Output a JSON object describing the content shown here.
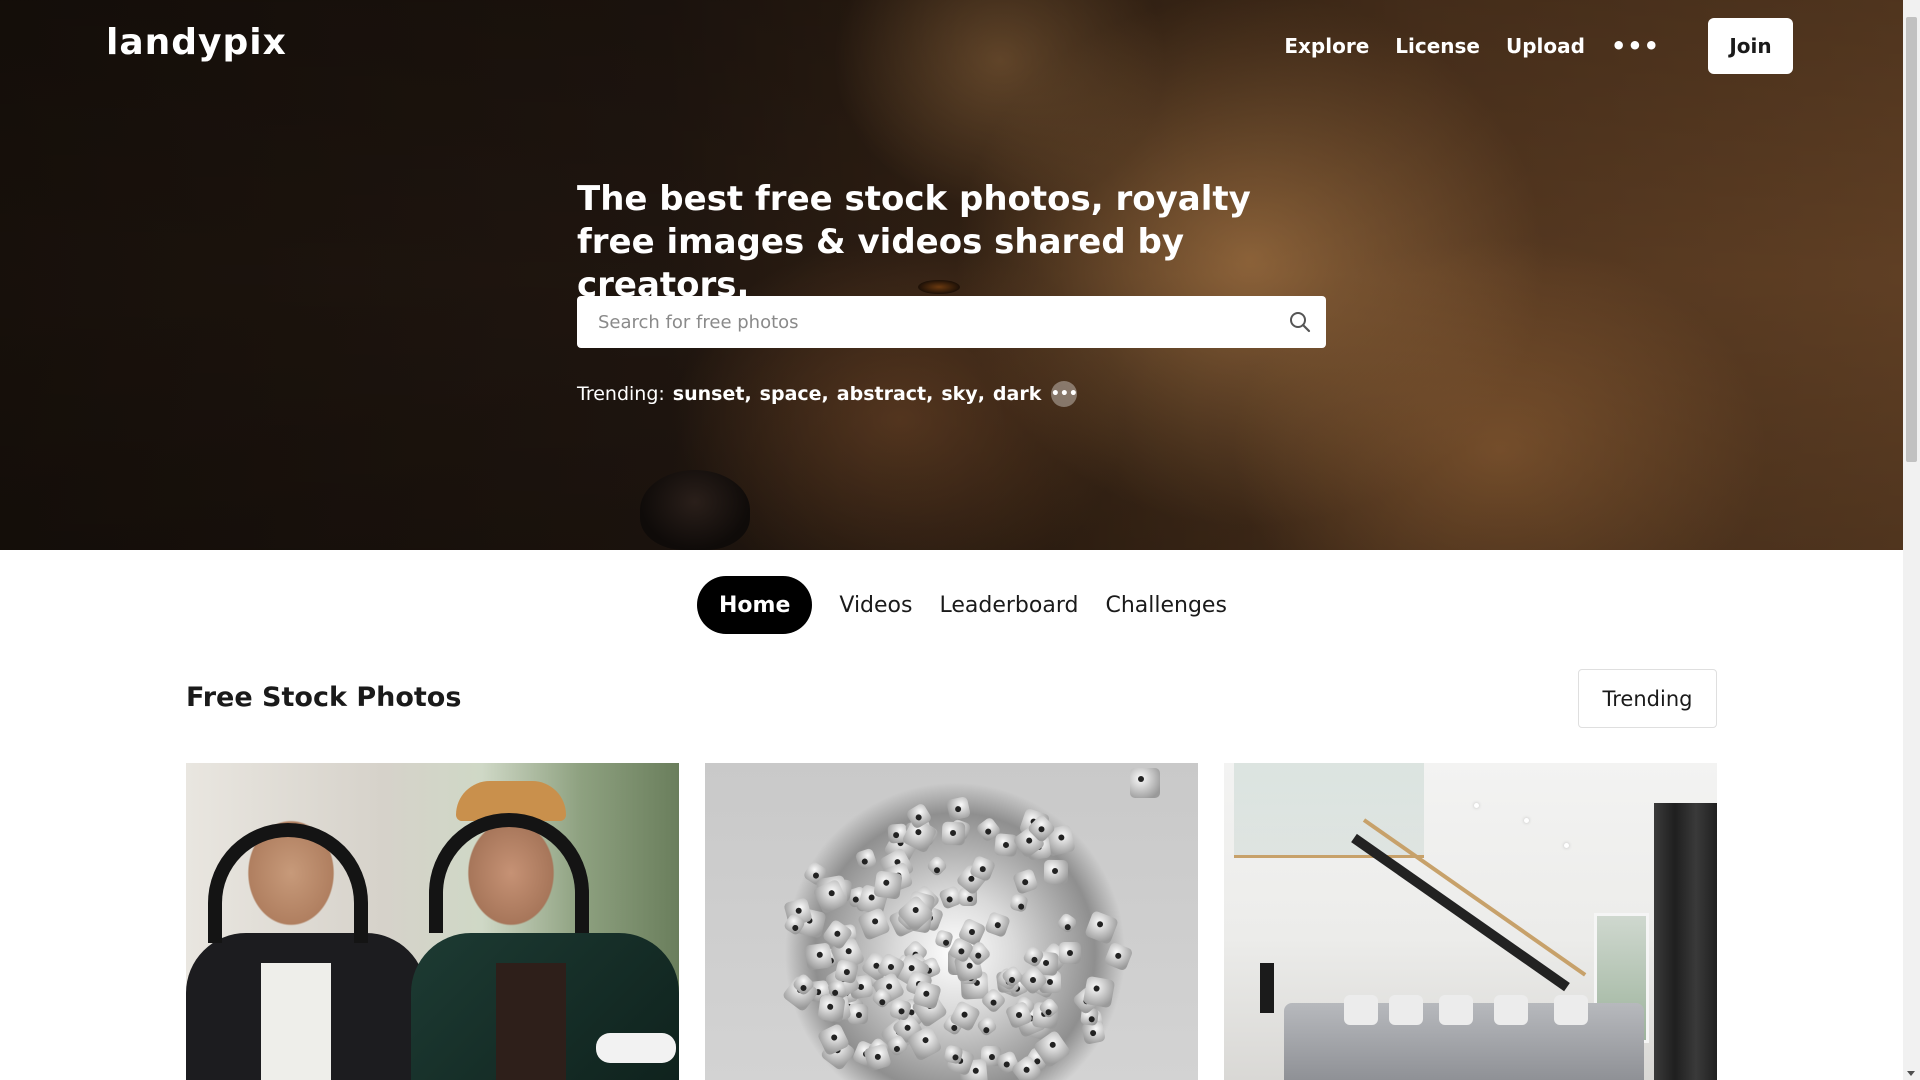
{
  "header": {
    "logo": "landypix",
    "nav": [
      "Explore",
      "License",
      "Upload"
    ],
    "more_label": "•••",
    "join_label": "Join"
  },
  "hero": {
    "title": "The best free stock photos, royalty free images & videos shared by creators.",
    "search": {
      "placeholder": "Search for free photos",
      "icon": "search-icon"
    },
    "trending": {
      "label": "Trending:",
      "tags": [
        "sunset",
        "space",
        "abstract",
        "sky",
        "dark"
      ],
      "more_label": "•••"
    }
  },
  "tabs": [
    {
      "label": "Home",
      "active": true
    },
    {
      "label": "Videos",
      "active": false
    },
    {
      "label": "Leaderboard",
      "active": false
    },
    {
      "label": "Challenges",
      "active": false
    }
  ],
  "feed": {
    "title": "Free Stock Photos",
    "sort_label": "Trending"
  },
  "colors": {
    "active_tab_bg": "#000000",
    "active_tab_text": "#ffffff",
    "hero_text": "#ffffff"
  }
}
